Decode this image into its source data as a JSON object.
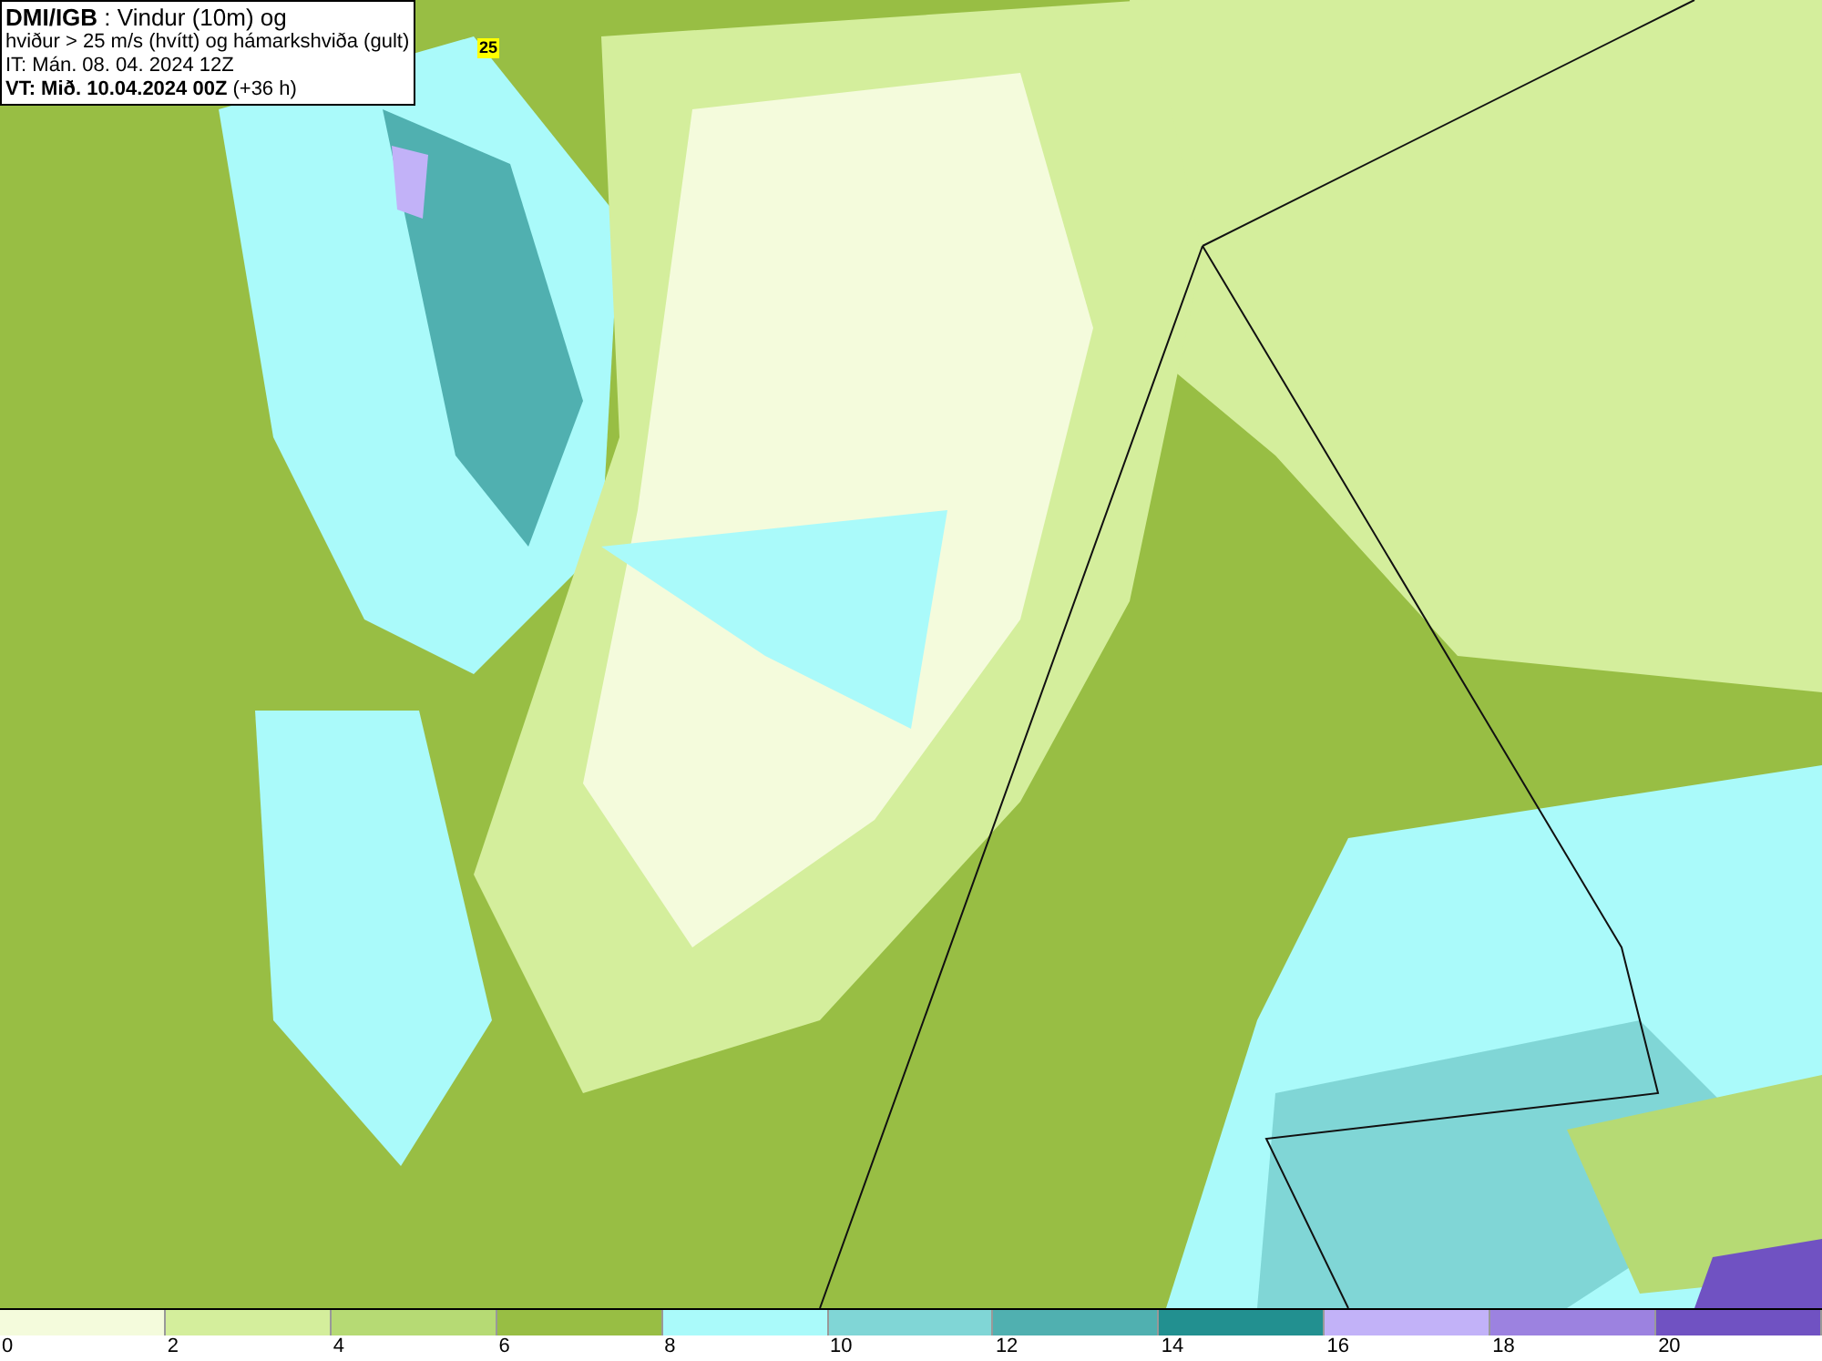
{
  "title_box": {
    "lines": [
      "**DMI/IGB** : Vindur (10m) og",
      "hviður > 25 m/s (hvítt) og hámarkshviða (gult)",
      "IT: Mán. 08. 04. 2024 12Z",
      "**VT: Mið. 10.04.2024 00Z** (+36 h)"
    ]
  },
  "gust_labels": [
    {
      "text": "25"
    }
  ],
  "legend": {
    "bins": [
      {
        "label": "0",
        "color": "#f4fbdc"
      },
      {
        "label": "2",
        "color": "#d4ee9c"
      },
      {
        "label": "4",
        "color": "#b6da74"
      },
      {
        "label": "6",
        "color": "#98be44"
      },
      {
        "label": "8",
        "color": "#aafafa"
      },
      {
        "label": "10",
        "color": "#80d6d6"
      },
      {
        "label": "12",
        "color": "#50b0b0"
      },
      {
        "label": "14",
        "color": "#229090"
      },
      {
        "label": "16",
        "color": "#c2b2f8"
      },
      {
        "label": "18",
        "color": "#9c82e0"
      },
      {
        "label": "20",
        "color": "#7052c2"
      }
    ]
  }
}
